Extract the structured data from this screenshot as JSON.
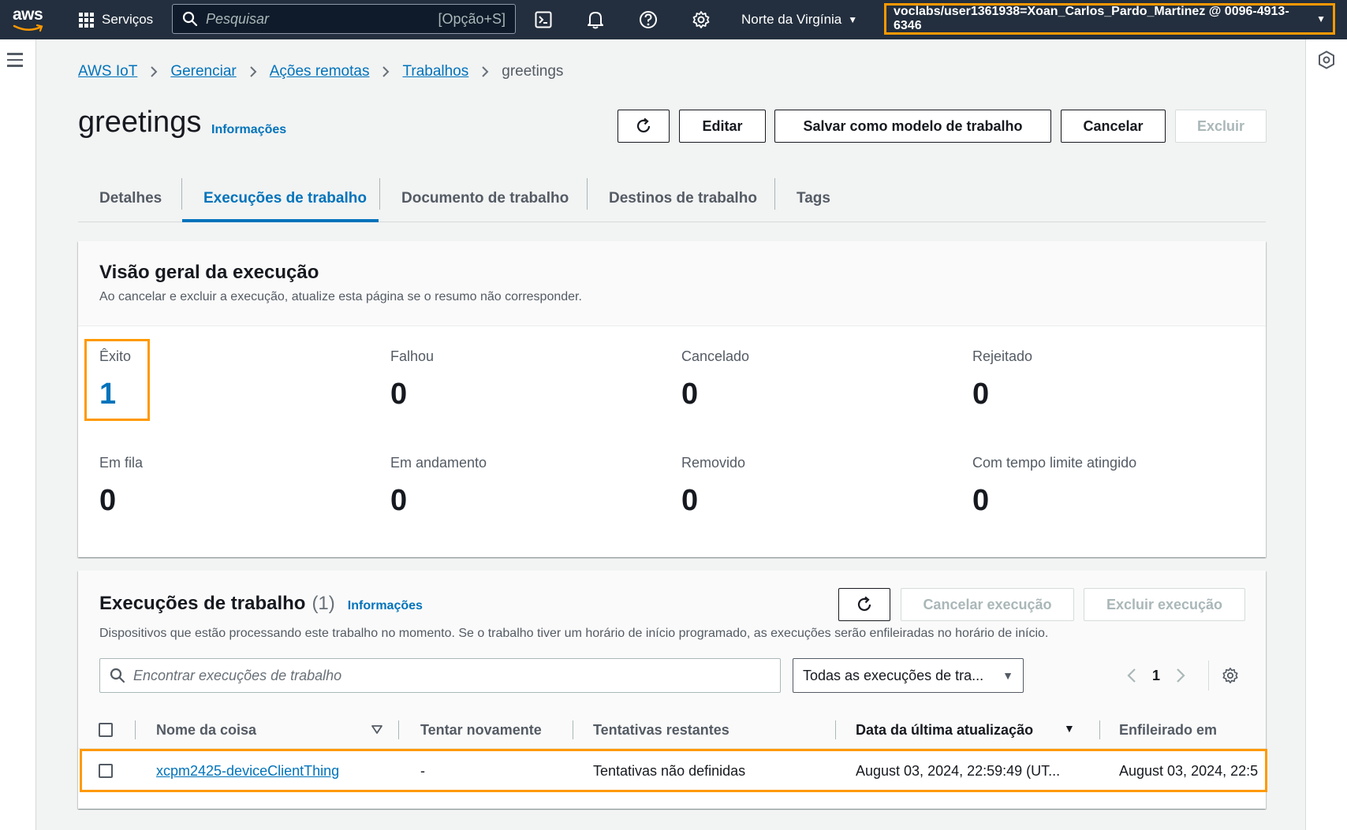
{
  "topnav": {
    "logo": "aws",
    "services_label": "Serviços",
    "search_placeholder": "Pesquisar",
    "search_shortcut": "[Opção+S]",
    "icons": [
      "cloudshell-icon",
      "bell-icon",
      "help-icon",
      "gear-icon"
    ],
    "region": "Norte da Virgínia",
    "account": "voclabs/user1361938=Xoan_Carlos_Pardo_Martinez @ 0096-4913-6346"
  },
  "breadcrumb": {
    "items": [
      "AWS IoT",
      "Gerenciar",
      "Ações remotas",
      "Trabalhos"
    ],
    "current": "greetings"
  },
  "header": {
    "title": "greetings",
    "info": "Informações",
    "buttons": {
      "edit": "Editar",
      "save_template": "Salvar como modelo de trabalho",
      "cancel": "Cancelar",
      "delete": "Excluir"
    }
  },
  "tabs": [
    "Detalhes",
    "Execuções de trabalho",
    "Documento de trabalho",
    "Destinos de trabalho",
    "Tags"
  ],
  "active_tab": "Execuções de trabalho",
  "overview": {
    "title": "Visão geral da execução",
    "description": "Ao cancelar e excluir a execução, atualize esta página se o resumo não corresponder.",
    "stats": [
      {
        "label": "Êxito",
        "value": "1"
      },
      {
        "label": "Falhou",
        "value": "0"
      },
      {
        "label": "Cancelado",
        "value": "0"
      },
      {
        "label": "Rejeitado",
        "value": "0"
      },
      {
        "label": "Em fila",
        "value": "0"
      },
      {
        "label": "Em andamento",
        "value": "0"
      },
      {
        "label": "Removido",
        "value": "0"
      },
      {
        "label": "Com tempo limite atingido",
        "value": "0"
      }
    ]
  },
  "executions": {
    "title": "Execuções de trabalho",
    "count": "(1)",
    "info": "Informações",
    "description": "Dispositivos que estão processando este trabalho no momento. Se o trabalho tiver um horário de início programado, as execuções serão enfileiradas no horário de início.",
    "cancel_button": "Cancelar execução",
    "delete_button": "Excluir execução",
    "search_placeholder": "Encontrar execuções de trabalho",
    "filter_value": "Todas as execuções de tra...",
    "page": "1",
    "columns": [
      "Nome da coisa",
      "Tentar novamente",
      "Tentativas restantes",
      "Data da última atualização",
      "Enfileirado em"
    ],
    "rows": [
      {
        "thing": "xcpm2425-deviceClientThing",
        "retry": "-",
        "attempts": "Tentativas não definidas",
        "last_update": "August 03, 2024, 22:59:49 (UT...",
        "queued": "August 03, 2024, 22:5"
      }
    ]
  },
  "colors": {
    "nav_bg": "#232f3e",
    "link": "#0073bb",
    "highlight": "#ff9900",
    "page_bg": "#f2f3f3"
  }
}
